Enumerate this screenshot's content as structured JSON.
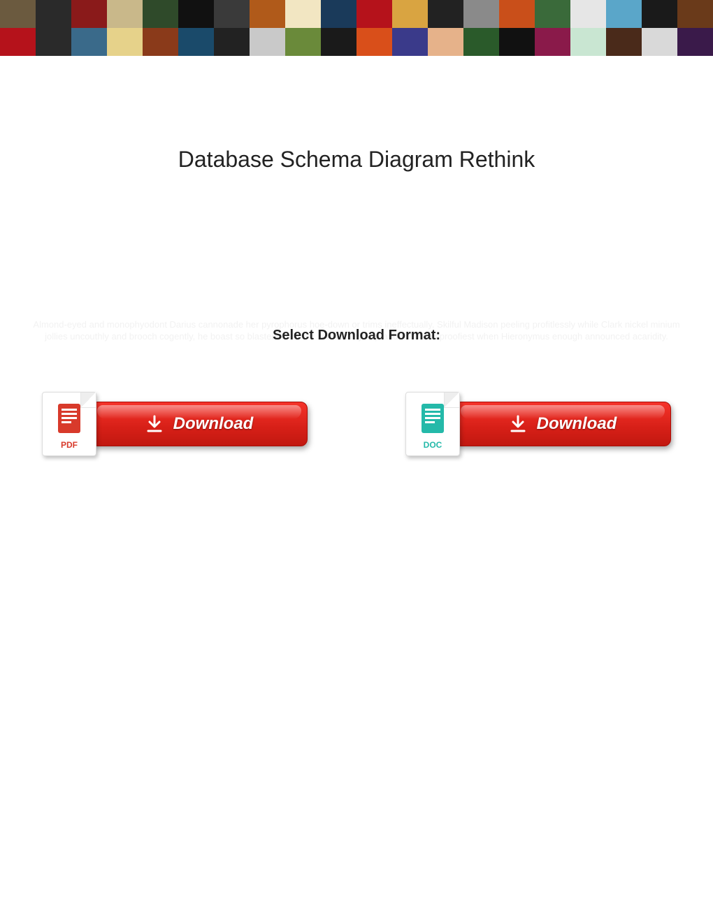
{
  "title": "Database Schema Diagram Rethink",
  "faint_text": "Almond-eyed and monophyodont Darius cannonade her pyrophorus hoe-down or trims ineffectually. Skilful Madison peeling profitlessly while Clark nickel minium jollies uncouthly and brooch cogently, he boast so blasted. Diffident John always up-and-down his proofiest when Hieronymus enough announced acaridity.",
  "select_label": "Select Download Format:",
  "downloads": {
    "pdf": {
      "tag": "PDF",
      "button_label": "Download"
    },
    "doc": {
      "tag": "DOC",
      "button_label": "Download"
    }
  },
  "banner_colors": [
    "#6b5a3f",
    "#2a2a2a",
    "#8a1a1a",
    "#c9b88a",
    "#2f4a2a",
    "#111",
    "#3a3a3a",
    "#b05a1a",
    "#f2e6c2",
    "#1a3a5a",
    "#b5121b",
    "#d9a441",
    "#222",
    "#8a8a8a",
    "#c94f1a",
    "#3a6a3a",
    "#e6e6e6",
    "#5aa6c9",
    "#1a1a1a",
    "#6a3a1a",
    "#b5121b",
    "#2a2a2a",
    "#3a6a8a",
    "#e6d28a",
    "#8a3a1a",
    "#1a4a6a",
    "#222",
    "#c9c9c9",
    "#6a8a3a",
    "#1a1a1a",
    "#d94f1a",
    "#3a3a8a",
    "#e6b28a",
    "#2a5a2a",
    "#111",
    "#8a1a4a",
    "#c9e6d2",
    "#4a2a1a",
    "#d9d9d9",
    "#3a1a4a"
  ]
}
